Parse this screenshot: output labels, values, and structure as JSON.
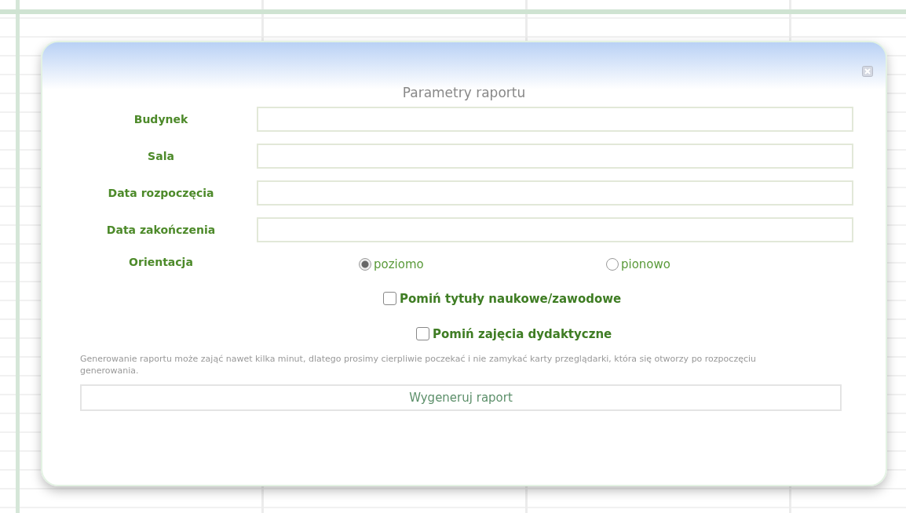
{
  "dialog": {
    "title": "Parametry raportu",
    "fields": [
      {
        "label": "Budynek"
      },
      {
        "label": "Sala"
      },
      {
        "label": "Data rozpoczęcia"
      },
      {
        "label": "Data zakończenia"
      }
    ],
    "orientation": {
      "label": "Orientacja",
      "options": [
        {
          "label": "poziomo",
          "selected": true
        },
        {
          "label": "pionowo",
          "selected": false
        }
      ]
    },
    "checkboxes": [
      {
        "label": "Pomiń tytuły naukowe/zawodowe",
        "checked": false
      },
      {
        "label": "Pomiń zajęcia dydaktyczne",
        "checked": false
      }
    ],
    "note": "Generowanie raportu może zająć nawet kilka minut, dlatego prosimy cierpliwie poczekać i nie zamykać karty przeglądarki, która się otworzy po rozpoczęciu generowania.",
    "button": "Wygeneruj raport"
  }
}
